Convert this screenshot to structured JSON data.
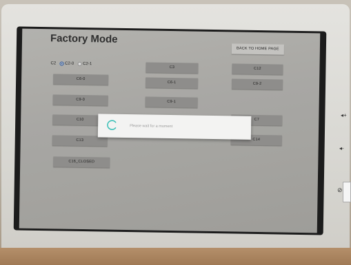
{
  "page": {
    "title": "Factory Mode",
    "back_button": "BACK TO HOME PAGE"
  },
  "radio_group": {
    "label": "C2",
    "options": [
      {
        "label": "C2-0",
        "selected": true
      },
      {
        "label": "C2-1",
        "selected": false
      }
    ]
  },
  "buttons": {
    "c6_0": "C6-0",
    "c9_0": "C9-0",
    "c10": "C10",
    "c13": "C13",
    "c16_closed": "C16_CLOSED",
    "c3": "C3",
    "c6_1": "C6-1",
    "c9_1": "C9-1",
    "c12": "C12",
    "c9_2": "C9-2",
    "c7": "C7",
    "c14": "C14"
  },
  "dialog": {
    "message": "Please wait for a moment"
  },
  "device_controls": {
    "volume_up": "◂+",
    "volume_down": "◂-"
  },
  "colors": {
    "spinner": "#3fc1b8",
    "radio_selected": "#2a5aa8"
  }
}
